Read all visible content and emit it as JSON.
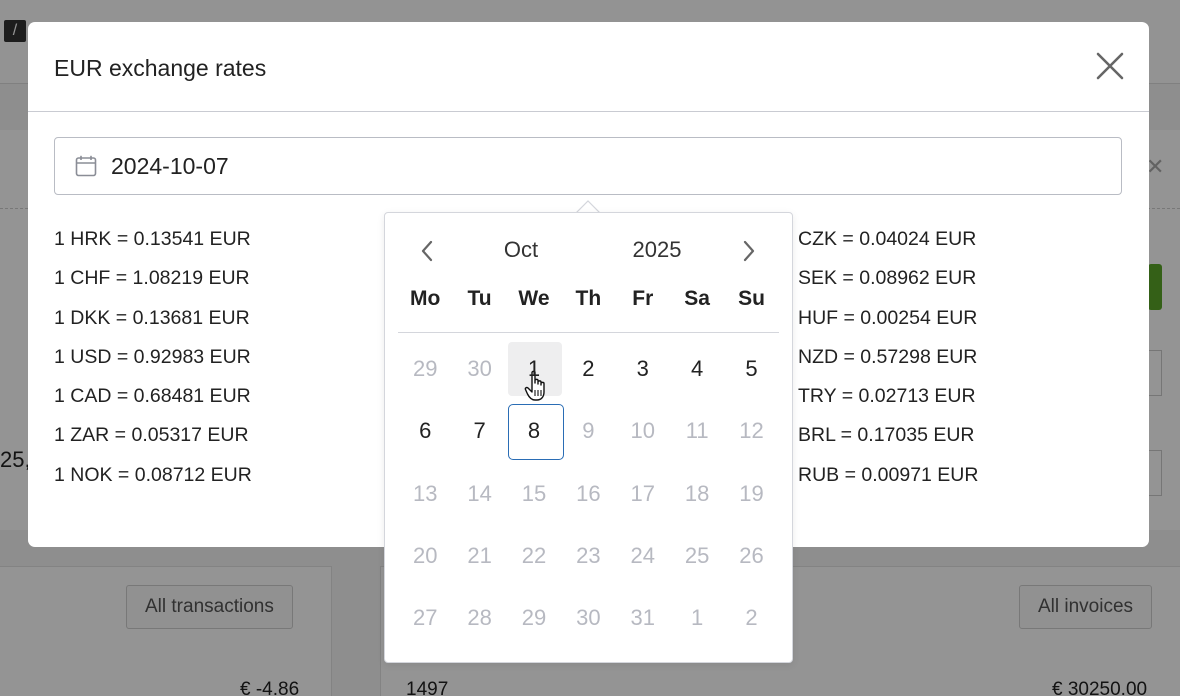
{
  "background": {
    "tile_glyph": "/",
    "all_transactions_label": "All transactions",
    "all_invoices_label": "All invoices",
    "value_a": "€ -4.86",
    "value_b": "1497",
    "value_c": "€ 30250.00",
    "fragment": "25,"
  },
  "modal": {
    "title": "EUR exchange rates",
    "date_value": "2024-10-07",
    "rates_left": [
      "1 HRK = 0.13541 EUR",
      "1 CHF = 1.08219 EUR",
      "1 DKK = 0.13681 EUR",
      "1 USD = 0.92983 EUR",
      "1 CAD = 0.68481 EUR",
      "1 ZAR = 0.05317 EUR",
      "1 NOK = 0.08712 EUR"
    ],
    "rates_right": [
      "CZK = 0.04024 EUR",
      "SEK = 0.08962 EUR",
      "HUF = 0.00254 EUR",
      "NZD = 0.57298 EUR",
      "TRY = 0.02713 EUR",
      "BRL = 0.17035 EUR",
      "RUB = 0.00971 EUR"
    ]
  },
  "datepicker": {
    "month": "Oct",
    "year": "2025",
    "weekdays": [
      "Mo",
      "Tu",
      "We",
      "Th",
      "Fr",
      "Sa",
      "Su"
    ],
    "weeks": [
      [
        {
          "d": "29",
          "m": true
        },
        {
          "d": "30",
          "m": true
        },
        {
          "d": "1",
          "h": true
        },
        {
          "d": "2"
        },
        {
          "d": "3"
        },
        {
          "d": "4"
        },
        {
          "d": "5"
        }
      ],
      [
        {
          "d": "6"
        },
        {
          "d": "7"
        },
        {
          "d": "8",
          "s": true
        },
        {
          "d": "9",
          "m": true
        },
        {
          "d": "10",
          "m": true
        },
        {
          "d": "11",
          "m": true
        },
        {
          "d": "12",
          "m": true
        }
      ],
      [
        {
          "d": "13",
          "m": true
        },
        {
          "d": "14",
          "m": true
        },
        {
          "d": "15",
          "m": true
        },
        {
          "d": "16",
          "m": true
        },
        {
          "d": "17",
          "m": true
        },
        {
          "d": "18",
          "m": true
        },
        {
          "d": "19",
          "m": true
        }
      ],
      [
        {
          "d": "20",
          "m": true
        },
        {
          "d": "21",
          "m": true
        },
        {
          "d": "22",
          "m": true
        },
        {
          "d": "23",
          "m": true
        },
        {
          "d": "24",
          "m": true
        },
        {
          "d": "25",
          "m": true
        },
        {
          "d": "26",
          "m": true
        }
      ],
      [
        {
          "d": "27",
          "m": true
        },
        {
          "d": "28",
          "m": true
        },
        {
          "d": "29",
          "m": true
        },
        {
          "d": "30",
          "m": true
        },
        {
          "d": "31",
          "m": true
        },
        {
          "d": "1",
          "m": true
        },
        {
          "d": "2",
          "m": true
        }
      ]
    ]
  },
  "colors": {
    "selected_border": "#2a6db5",
    "muted_day": "#b7b9c1",
    "hover_bg": "#eeeeef"
  }
}
